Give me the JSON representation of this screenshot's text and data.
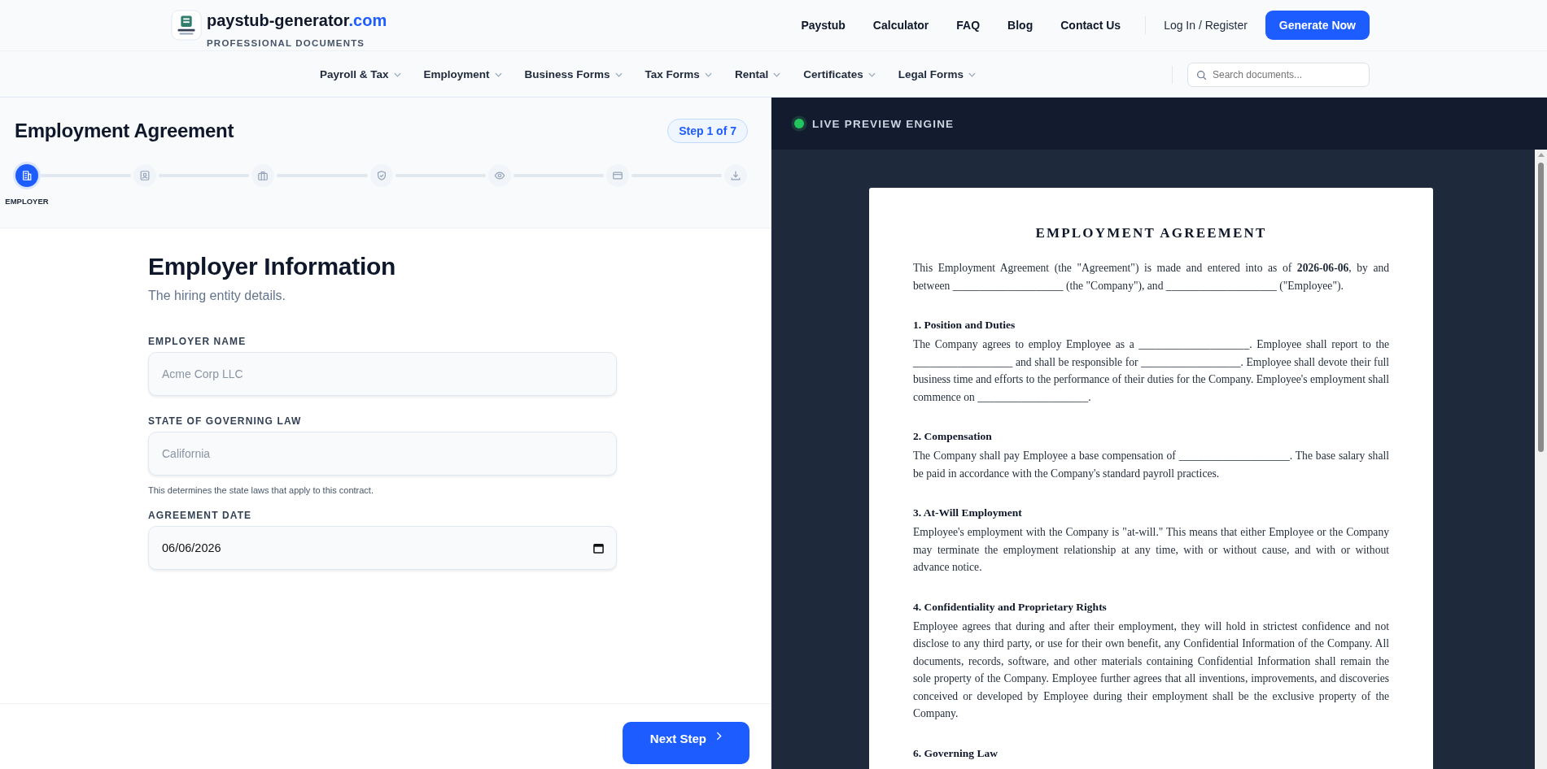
{
  "brand": {
    "name": "paystub-generator",
    "tld": ".com",
    "tagline": "PROFESSIONAL DOCUMENTS"
  },
  "top_links": [
    "Paystub",
    "Calculator",
    "FAQ",
    "Blog",
    "Contact Us"
  ],
  "login": "Log In / Register",
  "cta": "Generate Now",
  "nav": [
    "Payroll & Tax",
    "Employment",
    "Business Forms",
    "Tax Forms",
    "Rental",
    "Certificates",
    "Legal Forms"
  ],
  "search": {
    "placeholder": "Search documents..."
  },
  "wizard": {
    "title": "Employment Agreement",
    "step_badge": "Step 1 of 7",
    "steps": [
      {
        "selected": true,
        "label": "EMPLOYER"
      },
      {
        "selected": false
      },
      {
        "selected": false
      },
      {
        "selected": false
      },
      {
        "selected": false
      },
      {
        "selected": false
      },
      {
        "selected": false
      }
    ]
  },
  "form": {
    "heading": "Employer Information",
    "subtitle": "The hiring entity details.",
    "fields": [
      {
        "kind": "text",
        "label": "EMPLOYER NAME",
        "placeholder": "Acme Corp LLC"
      },
      {
        "kind": "text",
        "label": "STATE OF GOVERNING LAW",
        "placeholder": "California",
        "help": "This determines the state laws that apply to this contract."
      },
      {
        "kind": "date",
        "label": "AGREEMENT DATE",
        "value": "06/06/2026"
      }
    ],
    "next_button": "Next Step"
  },
  "preview": {
    "header": "LIVE PREVIEW ENGINE",
    "document": {
      "title": "EMPLOYMENT AGREEMENT",
      "intro": "This Employment Agreement (the \"Agreement\") is made and entered into as of **2026-06-06**, by and between ____________________ (the \"Company\"), and ____________________ (\"Employee\").",
      "sections": [
        {
          "heading": "1. Position and Duties",
          "text": "The Company agrees to employ Employee as a ____________________. Employee shall report to the __________________ and shall be responsible for __________________. Employee shall devote their full business time and efforts to the performance of their duties for the Company. Employee's employment shall commence on ____________________."
        },
        {
          "heading": "2. Compensation",
          "text": "The Company shall pay Employee a base compensation of ____________________. The base salary shall be paid in accordance with the Company's standard payroll practices."
        },
        {
          "heading": "3. At-Will Employment",
          "text": "Employee's employment with the Company is \"at-will.\" This means that either Employee or the Company may terminate the employment relationship at any time, with or without cause, and with or without advance notice."
        },
        {
          "heading": "4. Confidentiality and Proprietary Rights",
          "text": "Employee agrees that during and after their employment, they will hold in strictest confidence and not disclose to any third party, or use for their own benefit, any Confidential Information of the Company. All documents, records, software, and other materials containing Confidential Information shall remain the sole property of the Company. Employee further agrees that all inventions, improvements, and discoveries conceived or developed by Employee during their employment shall be the exclusive property of the Company."
        },
        {
          "heading": "6. Governing Law"
        }
      ]
    }
  }
}
